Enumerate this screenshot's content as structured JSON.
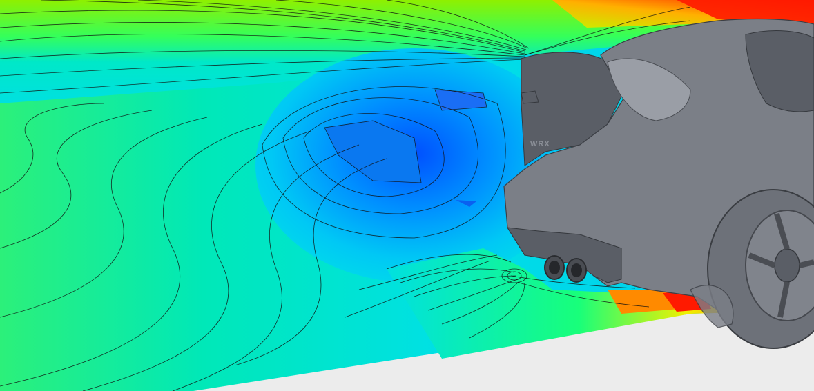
{
  "scene": {
    "subject": "car-rear-wake-contour",
    "badge_text": "WRX",
    "colors": {
      "low": "#0a3cff",
      "mid_low": "#00aaff",
      "mid": "#00e5e5",
      "mid_high": "#3dff4a",
      "high_mid": "#e5f000",
      "high": "#ff9000",
      "max": "#ff1a00",
      "car": "#7b7f87",
      "floor": "#ececec"
    }
  }
}
